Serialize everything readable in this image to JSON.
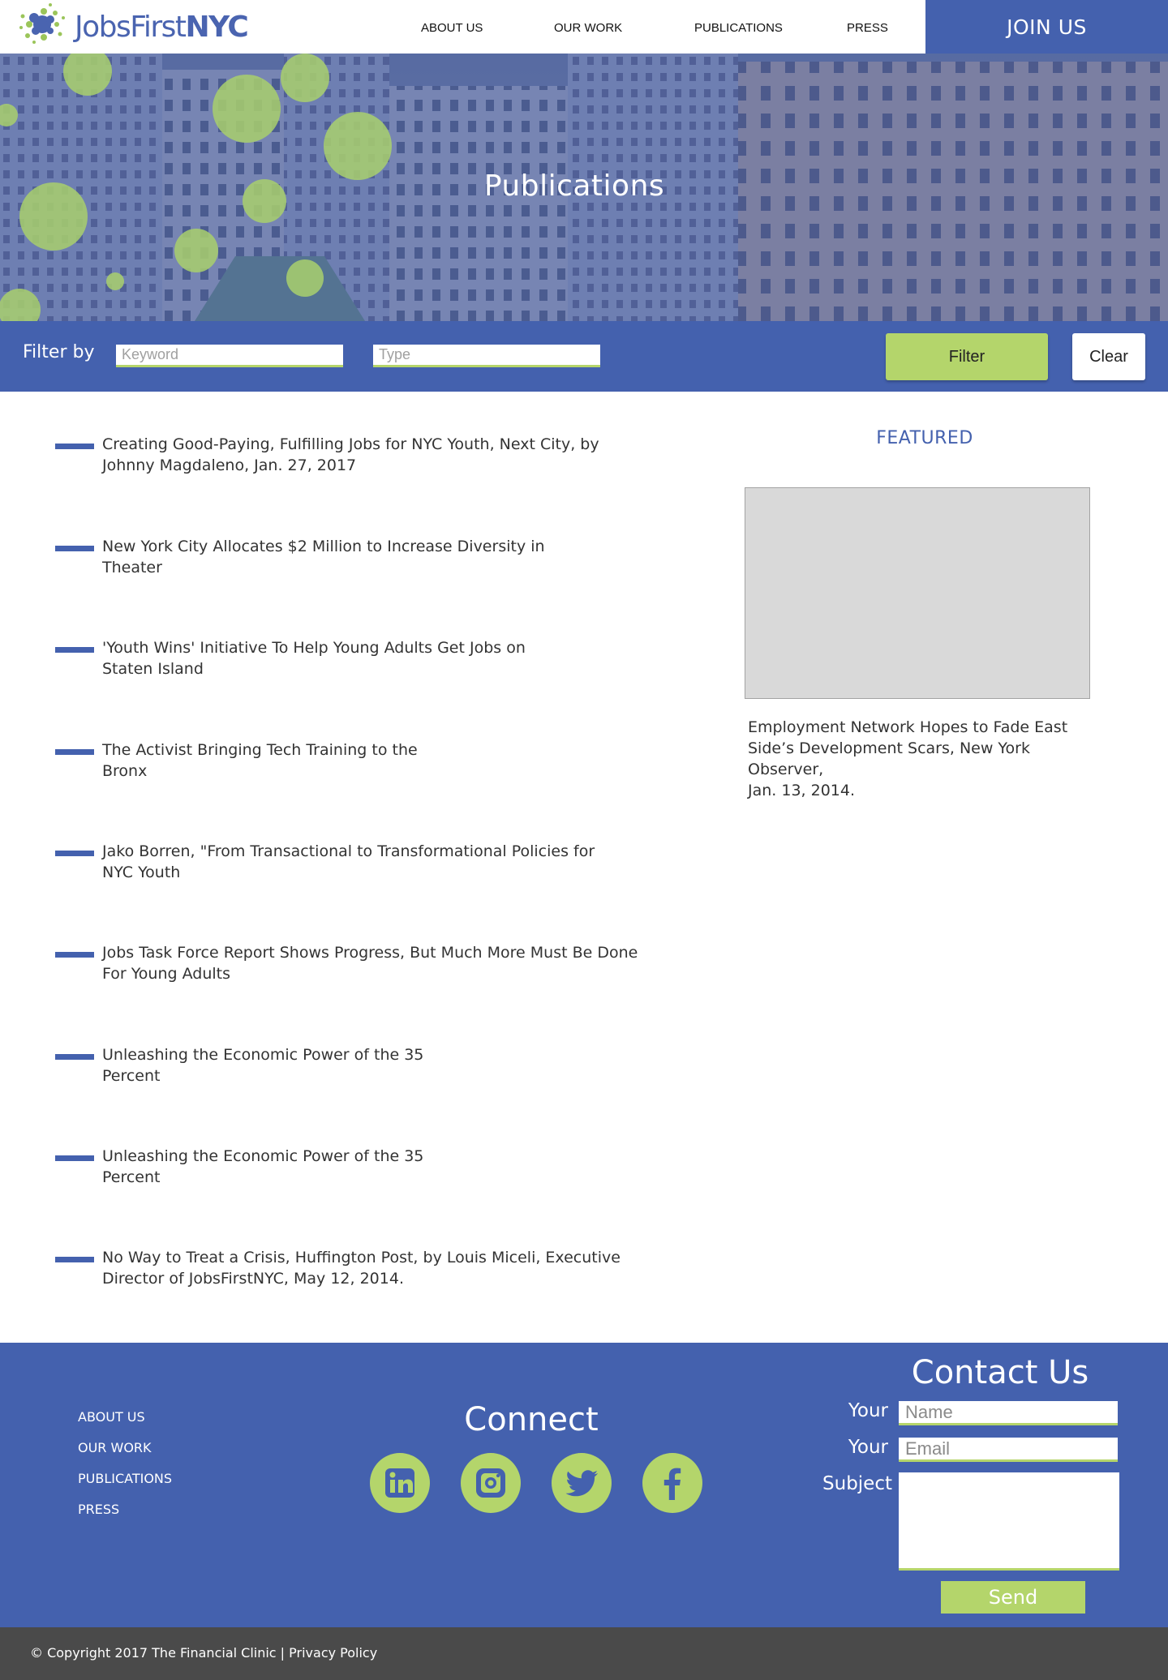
{
  "header": {
    "logo_first": "JobsFirst",
    "logo_second": "NYC",
    "nav": [
      "ABOUT US",
      "OUR WORK",
      "PUBLICATIONS",
      "PRESS"
    ],
    "join_label": "JOIN US"
  },
  "hero": {
    "title": "Publications"
  },
  "filter": {
    "label": "Filter by",
    "keyword_placeholder": "Keyword",
    "type_placeholder": "Type",
    "filter_button": "Filter",
    "clear_button": "Clear"
  },
  "publications": [
    {
      "line1": "Creating Good-Paying, Fulfilling Jobs for NYC Youth, Next City, by",
      "line2": "Johnny Magdaleno, Jan. 27, 2017"
    },
    {
      "line1": "New York City Allocates $2 Million to Increase Diversity in",
      "line2": "Theater"
    },
    {
      "line1": "'Youth Wins' Initiative To Help Young Adults Get Jobs on",
      "line2": "Staten Island"
    },
    {
      "line1": "The Activist Bringing Tech Training to the",
      "line2": "Bronx"
    },
    {
      "line1": "Jako Borren, \"From Transactional to Transformational Policies for",
      "line2": "NYC Youth"
    },
    {
      "line1": "Jobs Task Force Report Shows Progress, But Much More Must Be Done",
      "line2": "For Young Adults"
    },
    {
      "line1": "Unleashing the Economic Power of the 35",
      "line2": "Percent"
    },
    {
      "line1": "Unleashing the Economic Power of the 35",
      "line2": "Percent"
    },
    {
      "line1": "No Way to Treat a Crisis, Huffington Post, by Louis Miceli, Executive",
      "line2": "Director of JobsFirstNYC, May 12, 2014."
    }
  ],
  "featured": {
    "title": "FEATURED",
    "caption_line1": "Employment Network Hopes to Fade East",
    "caption_line2": "Side’s Development Scars, New York Observer,",
    "caption_line3": "Jan. 13, 2014."
  },
  "footer": {
    "links": [
      "ABOUT US",
      "OUR WORK",
      "PUBLICATIONS",
      "PRESS"
    ],
    "connect_title": "Connect",
    "social_icons": [
      "linkedin-icon",
      "instagram-icon",
      "twitter-icon",
      "facebook-icon"
    ],
    "contact_title": "Contact Us",
    "name_label": "Your",
    "name_placeholder": "Name",
    "email_label": "Your",
    "email_placeholder": "Email",
    "subject_label": "Subject",
    "send_label": "Send"
  },
  "copyright": {
    "text": "© Copyright 2017 The Financial Clinic | ",
    "privacy": "Privacy Policy"
  },
  "colors": {
    "brand_blue": "#4461ae",
    "brand_green": "#b4d56b",
    "footer_dark": "#4a4a4a"
  }
}
